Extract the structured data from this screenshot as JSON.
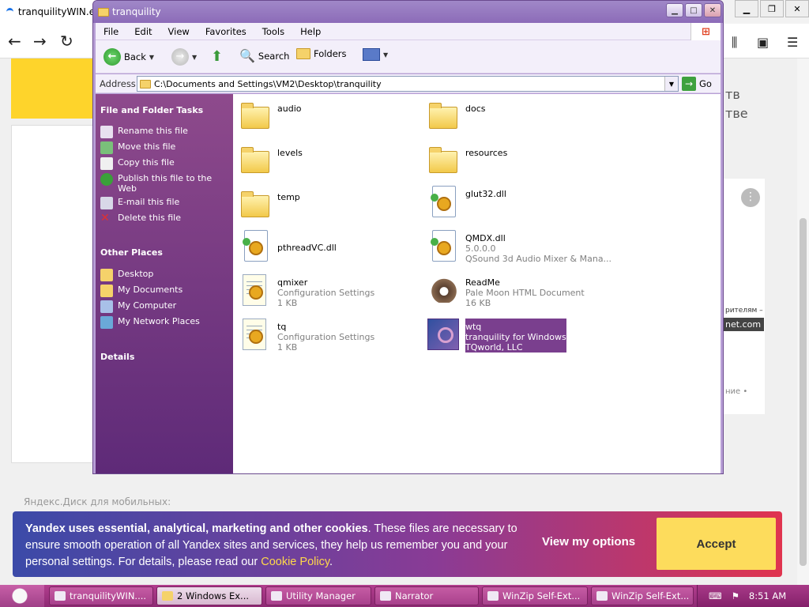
{
  "browser": {
    "tab_title": "tranquilityWIN.ex",
    "right_text_1": "тв",
    "right_text_2": "тве",
    "right_small": "рителям –",
    "right_badge": "net.com",
    "right_small_2": "ние •",
    "footer_label": "Яндекс.Диск для мобильных:"
  },
  "cookie_banner": {
    "bold_text": "Yandex uses essential, analytical, marketing and other cookies",
    "body_text": ". These files are necessary to ensure smooth operation of all Yandex sites and services, they help us remember you and your personal settings. For details, please read our ",
    "link_text": "Cookie Policy",
    "end_text": ".",
    "options_label": "View my options",
    "accept_label": "Accept",
    "colors": {
      "start": "#3b4aa8",
      "end": "#e0344f",
      "accept_bg": "#fddc5c",
      "link": "#ffd84a"
    }
  },
  "explorer": {
    "title": "tranquility",
    "menu": [
      "File",
      "Edit",
      "View",
      "Favorites",
      "Tools",
      "Help"
    ],
    "toolbar": {
      "back": "Back",
      "search": "Search",
      "folders": "Folders"
    },
    "address": {
      "label": "Address",
      "value": "C:\\Documents and Settings\\VM2\\Desktop\\tranquility",
      "go": "Go"
    },
    "left_pane": {
      "tasks_header": "File and Folder Tasks",
      "tasks": [
        "Rename this file",
        "Move this file",
        "Copy this file",
        "Publish this file to the Web",
        "E-mail this file",
        "Delete this file"
      ],
      "places_header": "Other Places",
      "places": [
        "Desktop",
        "My Documents",
        "My Computer",
        "My Network Places"
      ],
      "details_header": "Details"
    },
    "items": [
      {
        "name": "audio",
        "icon": "folder-icon"
      },
      {
        "name": "docs",
        "icon": "folder-icon"
      },
      {
        "name": "levels",
        "icon": "folder-icon"
      },
      {
        "name": "resources",
        "icon": "folder-icon"
      },
      {
        "name": "temp",
        "icon": "folder-icon"
      },
      {
        "name": "glut32.dll",
        "icon": "dll-icon"
      },
      {
        "name": "pthreadVC.dll",
        "icon": "dll-icon"
      },
      {
        "name": "QMDX.dll",
        "sub1": "5.0.0.0",
        "sub2": "QSound 3d Audio Mixer & Mana...",
        "icon": "dll-icon"
      },
      {
        "name": "qmixer",
        "sub1": "Configuration Settings",
        "sub2": "1 KB",
        "icon": "config-icon"
      },
      {
        "name": "ReadMe",
        "sub1": "Pale Moon HTML Document",
        "sub2": "16 KB",
        "icon": "palemoon-icon"
      },
      {
        "name": "tq",
        "sub1": "Configuration Settings",
        "sub2": "1 KB",
        "icon": "config-icon"
      },
      {
        "name": "wtq",
        "sub1": "tranquility for Windows",
        "sub2": "TQworld, LLC",
        "icon": "wtq-app-icon",
        "selected": true
      }
    ]
  },
  "taskbar": {
    "buttons": [
      "tranquilityWIN....",
      "2 Windows Ex...",
      "Utility Manager",
      "Narrator",
      "WinZip Self-Ext...",
      "WinZip Self-Ext..."
    ],
    "clock": "8:51 AM"
  }
}
